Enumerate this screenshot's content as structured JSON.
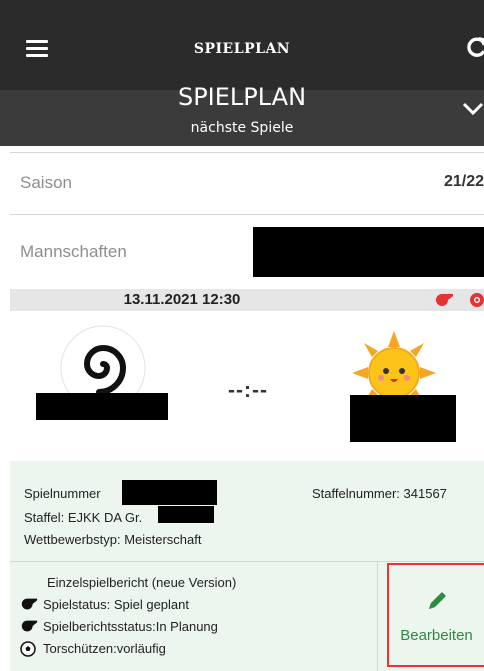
{
  "topbar": {
    "title": "SPIELPLAN"
  },
  "header": {
    "title": "SPIELPLAN",
    "subtitle": "nächste Spiele"
  },
  "filters": {
    "saison_label": "Saison",
    "saison_value": "21/22",
    "mannschaften_label": "Mannschaften"
  },
  "match": {
    "datetime": "13.11.2021 12:30",
    "score": "--:--"
  },
  "details": {
    "spielnummer_label": "Spielnummer",
    "staffelnummer": "Staffelnummer: 341567",
    "staffel": "Staffel: EJKK DA Gr.",
    "wettbewerbstyp": "Wettbewerbstyp: Meisterschaft"
  },
  "report": {
    "title": "Einzelspielbericht (neue Version)",
    "spielstatus": "Spielstatus: Spiel geplant",
    "spielberichtsstatus": "Spielberichtsstatus:In Planung",
    "torschuetzen": "Torschützen:vorläufig",
    "edit_label": "Bearbeiten"
  },
  "colors": {
    "topbar_bg": "#2b2b2b",
    "header_bg": "#3b3b3b",
    "accent_green": "#2e8a3e",
    "status_red": "#e33333",
    "details_bg": "#edf5ef"
  },
  "icons": [
    "menu-icon",
    "refresh-icon",
    "chevron-down-icon",
    "whistle-icon",
    "football-icon",
    "pencil-icon",
    "spiral-logo",
    "sun-logo"
  ]
}
